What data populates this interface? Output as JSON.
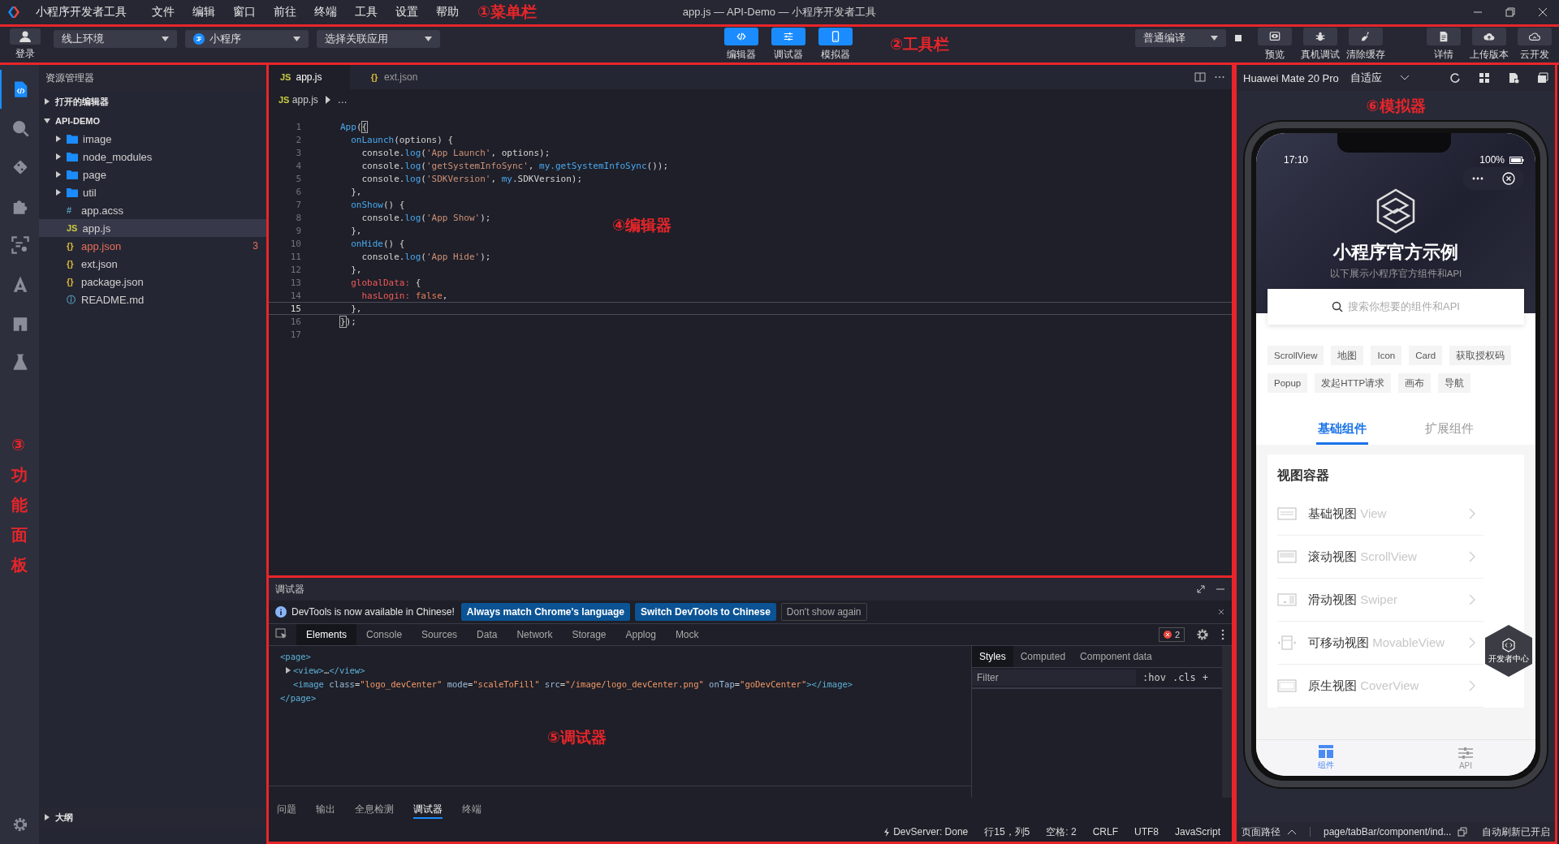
{
  "menu_bar": {
    "app_name": "小程序开发者工具",
    "items": [
      "文件",
      "编辑",
      "窗口",
      "前往",
      "终端",
      "工具",
      "设置",
      "帮助"
    ],
    "annotation": "①菜单栏",
    "title": "app.js — API-Demo — 小程序开发者工具"
  },
  "toolbar": {
    "login": "登录",
    "dropdowns": [
      {
        "kind": "plain",
        "value": "线上环境"
      },
      {
        "kind": "app",
        "value": "小程序"
      },
      {
        "kind": "plain",
        "value": "选择关联应用"
      }
    ],
    "view_toggles": [
      {
        "kind": "editor",
        "label": "编辑器",
        "on": true
      },
      {
        "kind": "debugger",
        "label": "调试器",
        "on": true
      },
      {
        "kind": "simulator",
        "label": "模拟器",
        "on": true
      }
    ],
    "annotation": "②工具栏",
    "compile_mode": "普通编译",
    "actions": [
      {
        "kind": "preview",
        "label": "预览"
      },
      {
        "kind": "bug",
        "label": "真机调试"
      },
      {
        "kind": "broom",
        "label": "清除缓存"
      }
    ],
    "project_actions": [
      {
        "kind": "doc",
        "label": "详情"
      },
      {
        "kind": "upload",
        "label": "上传版本"
      },
      {
        "kind": "cloud",
        "label": "云开发"
      }
    ]
  },
  "activity_bar": {
    "items": [
      {
        "kind": "files",
        "selected": true
      },
      {
        "kind": "search",
        "selected": false
      },
      {
        "kind": "git",
        "selected": false
      },
      {
        "kind": "puzzle",
        "selected": false
      },
      {
        "kind": "scan",
        "selected": false
      },
      {
        "kind": "font",
        "selected": false
      },
      {
        "kind": "store",
        "selected": false
      },
      {
        "kind": "flask",
        "selected": false
      }
    ],
    "annotation": "③功能面板"
  },
  "explorer": {
    "title": "资源管理器",
    "open_editors": {
      "label": "打开的编辑器",
      "expanded": false
    },
    "project": {
      "label": "API-DEMO",
      "expanded": true,
      "children": [
        {
          "name": "image",
          "kind": "folder",
          "expanded": false,
          "selected": false,
          "error": false
        },
        {
          "name": "node_modules",
          "kind": "folder",
          "expanded": false,
          "selected": false,
          "error": false
        },
        {
          "name": "page",
          "kind": "folder",
          "expanded": false,
          "selected": false,
          "error": false
        },
        {
          "name": "util",
          "kind": "folder",
          "expanded": false,
          "selected": false,
          "error": false
        },
        {
          "name": "app.acss",
          "kind": "css",
          "icon": "#",
          "selected": false,
          "error": false
        },
        {
          "name": "app.js",
          "kind": "js",
          "icon": "JS",
          "selected": true,
          "error": false
        },
        {
          "name": "app.json",
          "kind": "json",
          "icon": "{}",
          "selected": false,
          "error": true,
          "badge": "3"
        },
        {
          "name": "ext.json",
          "kind": "json",
          "icon": "{}",
          "selected": false,
          "error": false
        },
        {
          "name": "package.json",
          "kind": "json",
          "icon": "{}",
          "selected": false,
          "error": false
        },
        {
          "name": "README.md",
          "kind": "info",
          "icon": "ⓘ",
          "selected": false,
          "error": false
        }
      ]
    },
    "outline": {
      "label": "大纲",
      "expanded": false
    }
  },
  "editor": {
    "tabs": [
      {
        "label": "app.js",
        "kind": "js",
        "icon": "JS",
        "selected": true
      },
      {
        "label": "ext.json",
        "kind": "json",
        "icon": "{}",
        "selected": false
      }
    ],
    "breadcrumb": {
      "icon": "JS",
      "file": "app.js",
      "rest": "…"
    },
    "annotation": "④编辑器",
    "lines": [
      {
        "number": "1",
        "current": false,
        "tokens": [
          {
            "text": "App",
            "kind": "fn"
          },
          {
            "text": "(",
            "kind": "plain"
          },
          {
            "text": "{",
            "kind": "match"
          }
        ]
      },
      {
        "number": "2",
        "current": false,
        "tokens": [
          {
            "text": "  onLaunch",
            "kind": "fn"
          },
          {
            "text": "(options) {",
            "kind": "plain"
          }
        ]
      },
      {
        "number": "3",
        "current": false,
        "tokens": [
          {
            "text": "    console.",
            "kind": "plain"
          },
          {
            "text": "log",
            "kind": "fn"
          },
          {
            "text": "(",
            "kind": "plain"
          },
          {
            "text": "'App Launch'",
            "kind": "str"
          },
          {
            "text": ", options);",
            "kind": "plain"
          }
        ]
      },
      {
        "number": "4",
        "current": false,
        "tokens": [
          {
            "text": "    console.",
            "kind": "plain"
          },
          {
            "text": "log",
            "kind": "fn"
          },
          {
            "text": "(",
            "kind": "plain"
          },
          {
            "text": "'getSystemInfoSync'",
            "kind": "str"
          },
          {
            "text": ", ",
            "kind": "plain"
          },
          {
            "text": "my.getSystemInfoSync",
            "kind": "fn"
          },
          {
            "text": "());",
            "kind": "plain"
          }
        ]
      },
      {
        "number": "5",
        "current": false,
        "tokens": [
          {
            "text": "    console.",
            "kind": "plain"
          },
          {
            "text": "log",
            "kind": "fn"
          },
          {
            "text": "(",
            "kind": "plain"
          },
          {
            "text": "'SDKVersion'",
            "kind": "str"
          },
          {
            "text": ", ",
            "kind": "plain"
          },
          {
            "text": "my",
            "kind": "fn"
          },
          {
            "text": ".SDKVersion);",
            "kind": "plain"
          }
        ]
      },
      {
        "number": "6",
        "current": false,
        "tokens": [
          {
            "text": "  },",
            "kind": "plain"
          }
        ]
      },
      {
        "number": "7",
        "current": false,
        "tokens": [
          {
            "text": "  onShow",
            "kind": "fn"
          },
          {
            "text": "() {",
            "kind": "plain"
          }
        ]
      },
      {
        "number": "8",
        "current": false,
        "tokens": [
          {
            "text": "    console.",
            "kind": "plain"
          },
          {
            "text": "log",
            "kind": "fn"
          },
          {
            "text": "(",
            "kind": "plain"
          },
          {
            "text": "'App Show'",
            "kind": "str"
          },
          {
            "text": ");",
            "kind": "plain"
          }
        ]
      },
      {
        "number": "9",
        "current": false,
        "tokens": [
          {
            "text": "  },",
            "kind": "plain"
          }
        ]
      },
      {
        "number": "10",
        "current": false,
        "tokens": [
          {
            "text": "  onHide",
            "kind": "fn"
          },
          {
            "text": "() {",
            "kind": "plain"
          }
        ]
      },
      {
        "number": "11",
        "current": false,
        "tokens": [
          {
            "text": "    console.",
            "kind": "plain"
          },
          {
            "text": "log",
            "kind": "fn"
          },
          {
            "text": "(",
            "kind": "plain"
          },
          {
            "text": "'App Hide'",
            "kind": "str"
          },
          {
            "text": ");",
            "kind": "plain"
          }
        ]
      },
      {
        "number": "12",
        "current": false,
        "tokens": [
          {
            "text": "  },",
            "kind": "plain"
          }
        ]
      },
      {
        "number": "13",
        "current": false,
        "tokens": [
          {
            "text": "  globalData:",
            "kind": "prop"
          },
          {
            "text": " {",
            "kind": "plain"
          }
        ]
      },
      {
        "number": "14",
        "current": false,
        "tokens": [
          {
            "text": "    hasLogin:",
            "kind": "prop"
          },
          {
            "text": " false",
            "kind": "bool"
          },
          {
            "text": ",",
            "kind": "plain"
          }
        ]
      },
      {
        "number": "15",
        "current": true,
        "tokens": [
          {
            "text": "  },",
            "kind": "plain"
          }
        ]
      },
      {
        "number": "16",
        "current": false,
        "tokens": [
          {
            "text": "}",
            "kind": "match"
          },
          {
            "text": ");",
            "kind": "plain"
          }
        ]
      },
      {
        "number": "17",
        "current": false
      }
    ]
  },
  "debugger": {
    "title": "调试器",
    "notice": {
      "text": "DevTools is now available in Chinese!",
      "buttons": [
        {
          "label": "Always match Chrome's language",
          "kind": "primary"
        },
        {
          "label": "Switch DevTools to Chinese",
          "kind": "primary"
        },
        {
          "label": "Don't show again",
          "kind": "secondary"
        }
      ]
    },
    "tabs": [
      {
        "label": "Elements",
        "selected": true
      },
      {
        "label": "Console",
        "selected": false
      },
      {
        "label": "Sources",
        "selected": false
      },
      {
        "label": "Data",
        "selected": false
      },
      {
        "label": "Network",
        "selected": false
      },
      {
        "label": "Storage",
        "selected": false
      },
      {
        "label": "Applog",
        "selected": false
      },
      {
        "label": "Mock",
        "selected": false
      }
    ],
    "error_count": "2",
    "dom": [
      {
        "toggle": false,
        "tokens": [
          {
            "text": "<page>",
            "kind": "tag"
          }
        ],
        "close": [
          {
            "text": "</page>",
            "kind": "tag"
          }
        ],
        "children": [
          {
            "toggle": true,
            "tokens": [
              {
                "text": "<view>",
                "kind": "tag"
              },
              {
                "text": "…",
                "kind": "plain"
              },
              {
                "text": "</view>",
                "kind": "tag"
              }
            ]
          },
          {
            "toggle": false,
            "tokens": [
              {
                "text": "<image",
                "kind": "tag"
              },
              {
                "text": " class",
                "kind": "attr"
              },
              {
                "text": "=",
                "kind": "plain"
              },
              {
                "text": "\"logo_devCenter\"",
                "kind": "val"
              },
              {
                "text": " mode",
                "kind": "attr"
              },
              {
                "text": "=",
                "kind": "plain"
              },
              {
                "text": "\"scaleToFill\"",
                "kind": "val"
              },
              {
                "text": " src",
                "kind": "attr"
              },
              {
                "text": "=",
                "kind": "plain"
              },
              {
                "text": "\"/image/logo_devCenter.png\"",
                "kind": "val"
              },
              {
                "text": " onTap",
                "kind": "attr"
              },
              {
                "text": "=",
                "kind": "plain"
              },
              {
                "text": "\"goDevCenter\"",
                "kind": "val"
              },
              {
                "text": "></image>",
                "kind": "tag"
              }
            ]
          }
        ]
      }
    ],
    "styles_tabs": [
      {
        "label": "Styles",
        "selected": true
      },
      {
        "label": "Computed",
        "selected": false
      },
      {
        "label": "Component data",
        "selected": false
      }
    ],
    "filter_placeholder": "Filter",
    "style_buttons": [
      ":hov",
      ".cls",
      "+"
    ],
    "annotation": "⑤调试器",
    "panel_tabs": [
      {
        "label": "问题",
        "selected": false
      },
      {
        "label": "输出",
        "selected": false
      },
      {
        "label": "全息检测",
        "selected": false
      },
      {
        "label": "调试器",
        "selected": true
      },
      {
        "label": "终端",
        "selected": false
      }
    ],
    "status": [
      "DevServer: Done",
      "行15，列5",
      "空格: 2",
      "CRLF",
      "UTF8",
      "JavaScript"
    ]
  },
  "simulator": {
    "device": "Huawei Mate 20 Pro",
    "scale": "自适应",
    "annotation": "⑥模拟器",
    "phone": {
      "time": "17:10",
      "battery": "100%",
      "title": "小程序官方示例",
      "subtitle": "以下展示小程序官方组件和API",
      "search_placeholder": "搜索你想要的组件和API",
      "tags": [
        [
          "ScrollView",
          "地图",
          "Icon",
          "Card",
          "获取授权码"
        ],
        [
          "Popup",
          "发起HTTP请求",
          "画布",
          "导航"
        ]
      ],
      "tabs": [
        {
          "label": "基础组件",
          "selected": true
        },
        {
          "label": "扩展组件",
          "selected": false
        }
      ],
      "section_title": "视图容器",
      "items": [
        {
          "kind": "view",
          "name": "基础视图",
          "api": "View"
        },
        {
          "kind": "scroll",
          "name": "滚动视图",
          "api": "ScrollView"
        },
        {
          "kind": "swiper",
          "name": "滑动视图",
          "api": "Swiper"
        },
        {
          "kind": "movable",
          "name": "可移动视图",
          "api": "MovableView"
        },
        {
          "kind": "cover",
          "name": "原生视图",
          "api": "CoverView"
        }
      ],
      "dev_center": "开发者中心",
      "tab_bar": [
        {
          "kind": "components",
          "label": "组件",
          "selected": true
        },
        {
          "kind": "api",
          "label": "API",
          "selected": false
        }
      ]
    },
    "status": {
      "path_label": "页面路径",
      "path": "page/tabBar/component/ind...",
      "auto_refresh": "自动刷新已开启"
    }
  }
}
